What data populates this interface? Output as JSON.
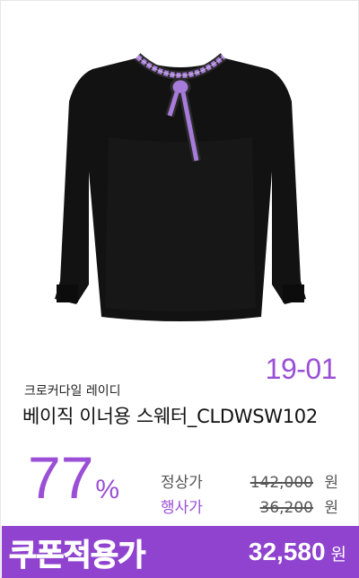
{
  "product": {
    "image_alt": "black sweater with purple striped tie collar",
    "season_code": "19-01",
    "brand": "크로커다일 레이디",
    "name": "베이직 이너용 스웨터_CLDWSW102"
  },
  "pricing": {
    "discount_number": "77",
    "discount_unit": "%",
    "regular_label": "정상가",
    "regular_price": "142,000",
    "sale_label": "행사가",
    "sale_price": "36,200",
    "currency": "원"
  },
  "coupon": {
    "label": "쿠폰적용가",
    "price": "32,580",
    "currency": "원"
  },
  "colors": {
    "accent": "#9a4fd6",
    "coupon_bg": "#8f43cf",
    "garment": "#121212",
    "stripe": "#a77bd9"
  },
  "icons": [
    "sweater-image"
  ]
}
